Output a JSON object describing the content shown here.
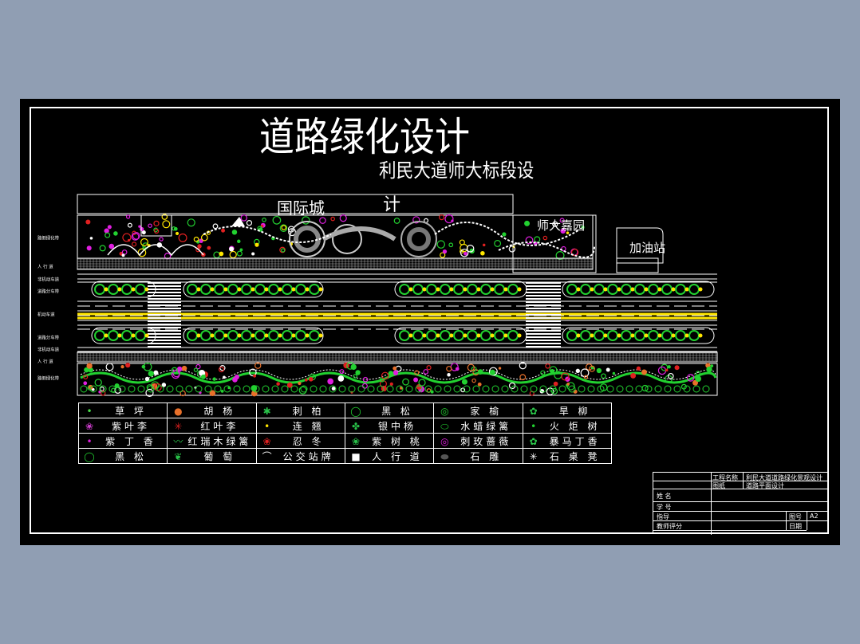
{
  "drawing": {
    "title": "道路绿化设计",
    "subtitle_line1": "利民大道师大标段设",
    "subtitle_line2": "计",
    "label_left_block": "国际城",
    "label_right_block": "师大嘉园",
    "label_station": "加油站"
  },
  "row_labels": [
    "路侧绿化带",
    "人 行 道",
    "非机动车道",
    "道路分车带",
    "机动车道",
    "道路分车带",
    "非机动车道",
    "人 行 道",
    "路侧绿化带"
  ],
  "legend": [
    [
      {
        "icon": "dot-icon",
        "color": "#4ade4a",
        "label": "草 坪"
      },
      {
        "icon": "blob-icon",
        "color": "#e8702a",
        "label": "胡 杨"
      },
      {
        "icon": "star-icon",
        "color": "#29c249",
        "label": "刺 柏"
      },
      {
        "icon": "circle-icon",
        "color": "#22d130",
        "label": "黑 松"
      },
      {
        "icon": "ring-icon",
        "color": "#22d130",
        "label": "家 榆"
      },
      {
        "icon": "spiral-icon",
        "color": "#2bc94a",
        "label": "旱 柳"
      }
    ],
    [
      {
        "icon": "flower-icon",
        "color": "#c93cc9",
        "label": "紫叶李"
      },
      {
        "icon": "asterisk-icon",
        "color": "#e02020",
        "label": "红叶李"
      },
      {
        "icon": "dot-icon",
        "color": "#ffe600",
        "label": "连 翘"
      },
      {
        "icon": "leaf-icon",
        "color": "#29c249",
        "label": "银中杨"
      },
      {
        "icon": "oval-icon",
        "color": "#22d130",
        "label": "水蜡绿篱"
      },
      {
        "icon": "dot-icon",
        "color": "#22d130",
        "label": "火 炬 树"
      }
    ],
    [
      {
        "icon": "dot-icon",
        "color": "#e01ee0",
        "label": "紫 丁 香"
      },
      {
        "icon": "wave-icon",
        "color": "#29c249",
        "label": "红瑞木绿篱"
      },
      {
        "icon": "flower-icon",
        "color": "#e02020",
        "label": "忍 冬"
      },
      {
        "icon": "flower-icon",
        "color": "#29c249",
        "label": "紫 树 桃"
      },
      {
        "icon": "ring-icon",
        "color": "#e01ee0",
        "label": "刺玫蔷薇"
      },
      {
        "icon": "spiral-icon",
        "color": "#2bc94a",
        "label": "暴马丁香"
      }
    ],
    [
      {
        "icon": "circle-icon",
        "color": "#22d130",
        "label": "黑 松"
      },
      {
        "icon": "vine-icon",
        "color": "#29c249",
        "label": "葡 萄"
      },
      {
        "icon": "bus-stop-icon",
        "color": "#ffffff",
        "label": "公交站牌"
      },
      {
        "icon": "square-icon",
        "color": "#ffffff",
        "label": "人 行 道"
      },
      {
        "icon": "rock-icon",
        "color": "#555555",
        "label": "石 雕"
      },
      {
        "icon": "asterisk-icon",
        "color": "#ffffff",
        "label": "石 桌 凳"
      }
    ]
  ],
  "title_block": {
    "project_name_label": "工程名称",
    "project_name": "利民大道道路绿化景观设计",
    "drawing_label": "图纸",
    "drawing_name": "道路平面设计",
    "rows": [
      "姓 名",
      "学 号",
      "指导",
      "教师评分"
    ],
    "sheet_no_label": "图号",
    "sheet_no": "A2",
    "date_label": "日期"
  },
  "colors": {
    "background": "#909eb3",
    "sheet": "#000000",
    "line": "#ffffff",
    "green": "#22d130",
    "yellow": "#ffe600",
    "magenta": "#e01ee0",
    "red": "#e02020",
    "orange": "#e8702a"
  }
}
